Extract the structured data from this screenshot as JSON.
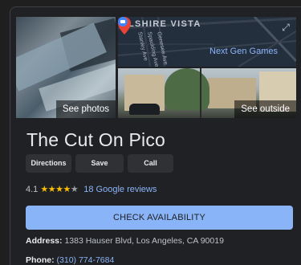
{
  "photos": {
    "left_caption": "See photos",
    "right_caption": "See outside",
    "map": {
      "street_label": "VILSHIRE VISTA",
      "streets": [
        "Stanley Ave",
        "Spaulding Ave",
        "Genesee Ave"
      ],
      "poi_label": "Next Gen Games",
      "pin_color": "#ea4335"
    }
  },
  "place": {
    "name": "The Cut On Pico",
    "rating": "4.1",
    "stars_filled": 4,
    "stars_total": 5,
    "reviews": "18 Google reviews"
  },
  "actions": {
    "directions": "Directions",
    "save": "Save",
    "call": "Call"
  },
  "cta": {
    "label": "CHECK AVAILABILITY",
    "color": "#8ab4f8"
  },
  "info": {
    "address_label": "Address:",
    "address_value": "1383 Hauser Blvd, Los Angeles, CA 90019",
    "phone_label": "Phone:",
    "phone_value": "(310) 774-7684"
  }
}
